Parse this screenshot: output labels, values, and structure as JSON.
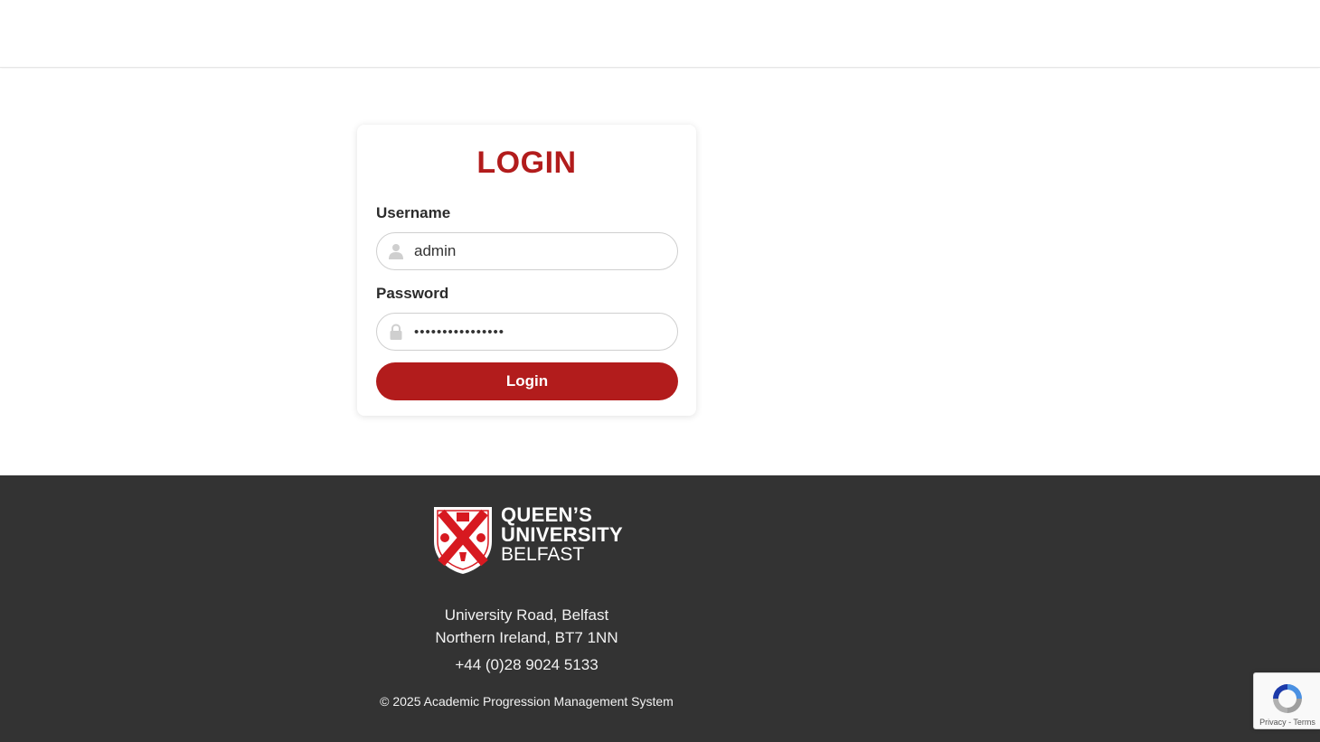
{
  "login": {
    "title": "LOGIN",
    "username_label": "Username",
    "username_value": "admin",
    "password_label": "Password",
    "password_value": "••••••••••••••••",
    "button_label": "Login"
  },
  "footer": {
    "logo": {
      "line1": "QUEEN’S",
      "line2": "UNIVERSITY",
      "line3": "BELFAST"
    },
    "address_line1": "University Road, Belfast",
    "address_line2": "Northern Ireland, BT7 1NN",
    "phone": "+44 (0)28 9024 5133",
    "copyright": "© 2025 Academic Progression Management System"
  },
  "recaptcha": {
    "links": "Privacy - Terms"
  },
  "colors": {
    "brand_red": "#b21c1c",
    "footer_bg": "#333333"
  }
}
